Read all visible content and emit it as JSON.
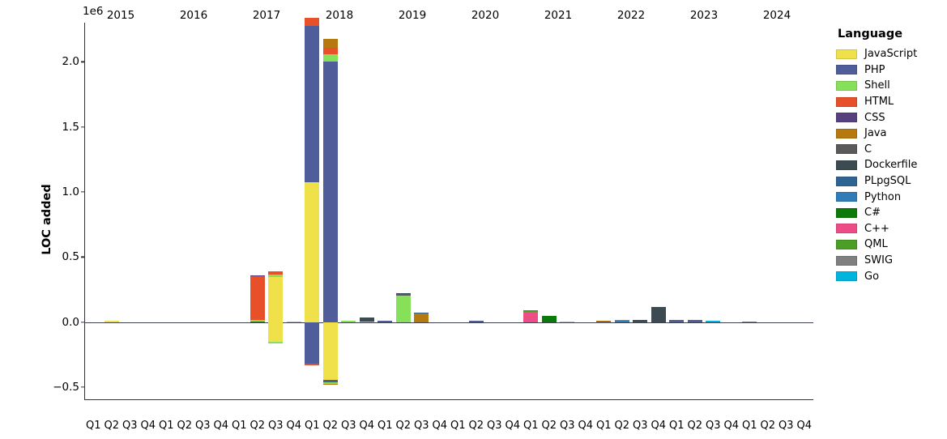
{
  "chart_data": {
    "type": "bar",
    "subtype": "stacked-bar",
    "title": "",
    "xlabel": "",
    "ylabel": "LOC added",
    "y_offset_label": "1e6",
    "ylim": [
      -600000,
      2300000
    ],
    "ytick_values": [
      -500000,
      0,
      500000,
      1000000,
      1500000,
      2000000
    ],
    "ytick_labels": [
      "−0.5",
      "0.0",
      "0.5",
      "1.0",
      "1.5",
      "2.0"
    ],
    "grid": false,
    "legend_position": "right",
    "legend_title": "Language",
    "quarter_labels": [
      "Q1",
      "Q2",
      "Q3",
      "Q4"
    ],
    "years": [
      "2015",
      "2016",
      "2017",
      "2018",
      "2019",
      "2020",
      "2021",
      "2022",
      "2023",
      "2024"
    ],
    "categories": [
      "2015Q1",
      "2015Q2",
      "2015Q3",
      "2015Q4",
      "2016Q1",
      "2016Q2",
      "2016Q3",
      "2016Q4",
      "2017Q1",
      "2017Q2",
      "2017Q3",
      "2017Q4",
      "2018Q1",
      "2018Q2",
      "2018Q3",
      "2018Q4",
      "2019Q1",
      "2019Q2",
      "2019Q3",
      "2019Q4",
      "2020Q1",
      "2020Q2",
      "2020Q3",
      "2020Q4",
      "2021Q1",
      "2021Q2",
      "2021Q3",
      "2021Q4",
      "2022Q1",
      "2022Q2",
      "2022Q3",
      "2022Q4",
      "2023Q1",
      "2023Q2",
      "2023Q3",
      "2023Q4",
      "2024Q1",
      "2024Q2",
      "2024Q3",
      "2024Q4"
    ],
    "series": [
      {
        "name": "JavaScript",
        "color": "#f0e14a",
        "values": [
          0,
          9000,
          0,
          0,
          0,
          0,
          0,
          0,
          0,
          0,
          345000,
          0,
          1075000,
          -16000,
          0,
          0,
          0,
          0,
          0,
          0,
          0,
          0,
          0,
          0,
          0,
          0,
          0,
          0,
          0,
          0,
          0,
          0,
          0,
          0,
          0,
          0,
          0,
          0,
          0,
          0
        ]
      },
      {
        "name": "PHP",
        "color": "#4f5d9b",
        "values": [
          0,
          0,
          0,
          0,
          0,
          0,
          0,
          0,
          0,
          5000,
          0,
          0,
          1200000,
          2000000,
          0,
          0,
          11000,
          0,
          0,
          0,
          0,
          10000,
          0,
          0,
          0,
          0,
          0,
          0,
          1500,
          0,
          0,
          0,
          17000,
          13000,
          0,
          0,
          0,
          0,
          0,
          0
        ]
      },
      {
        "name": "Shell",
        "color": "#86e05a",
        "values": [
          0,
          0,
          0,
          0,
          0,
          0,
          0,
          0,
          0,
          14000,
          22000,
          6000,
          0,
          60000,
          10000,
          4000,
          0,
          205000,
          0,
          0,
          0,
          0,
          0,
          0,
          0,
          0,
          3000,
          0,
          0,
          0,
          0,
          0,
          0,
          0,
          0,
          0,
          0,
          0,
          0,
          0
        ]
      },
      {
        "name": "HTML",
        "color": "#e8502a",
        "values": [
          0,
          0,
          0,
          0,
          0,
          0,
          0,
          0,
          0,
          334000,
          22000,
          0,
          65000,
          45000,
          0,
          0,
          0,
          0,
          0,
          0,
          0,
          0,
          0,
          0,
          0,
          0,
          0,
          0,
          0,
          0,
          0,
          0,
          0,
          0,
          0,
          0,
          0,
          0,
          0,
          0
        ]
      },
      {
        "name": "CSS",
        "color": "#56407e",
        "values": [
          0,
          0,
          0,
          0,
          0,
          0,
          0,
          0,
          0,
          4000,
          0,
          0,
          0,
          0,
          0,
          0,
          0,
          0,
          0,
          0,
          0,
          0,
          0,
          0,
          0,
          0,
          0,
          0,
          0,
          0,
          5000,
          0,
          0,
          0,
          0,
          0,
          0,
          0,
          0,
          0
        ]
      },
      {
        "name": "Java",
        "color": "#b5790f",
        "values": [
          0,
          0,
          0,
          0,
          0,
          0,
          0,
          0,
          0,
          0,
          0,
          0,
          0,
          70000,
          0,
          0,
          0,
          0,
          70000,
          0,
          0,
          0,
          0,
          0,
          0,
          0,
          0,
          0,
          10000,
          0,
          0,
          0,
          0,
          0,
          0,
          0,
          0,
          0,
          0,
          0
        ]
      },
      {
        "name": "C",
        "color": "#5a5a5a",
        "values": [
          0,
          0,
          0,
          0,
          0,
          0,
          0,
          0,
          0,
          0,
          0,
          0,
          0,
          0,
          0,
          0,
          0,
          11000,
          0,
          0,
          0,
          0,
          0,
          0,
          0,
          0,
          0,
          0,
          0,
          0,
          0,
          0,
          0,
          0,
          0,
          0,
          0,
          0,
          0,
          0
        ]
      },
      {
        "name": "Dockerfile",
        "color": "#3c4a52",
        "values": [
          0,
          0,
          0,
          0,
          0,
          0,
          0,
          0,
          0,
          0,
          0,
          0,
          0,
          0,
          0,
          28000,
          0,
          4000,
          0,
          0,
          0,
          0,
          0,
          0,
          0,
          0,
          0,
          0,
          0,
          0,
          9000,
          115000,
          0,
          0,
          0,
          0,
          0,
          0,
          0,
          0
        ]
      },
      {
        "name": "PLpgSQL",
        "color": "#2e6491",
        "values": [
          0,
          0,
          0,
          0,
          0,
          0,
          0,
          0,
          0,
          0,
          0,
          0,
          0,
          0,
          0,
          0,
          0,
          0,
          5000,
          0,
          0,
          0,
          0,
          0,
          0,
          0,
          0,
          0,
          0,
          0,
          0,
          0,
          0,
          0,
          0,
          0,
          0,
          0,
          0,
          0
        ]
      },
      {
        "name": "Python",
        "color": "#2f7cb8",
        "values": [
          0,
          0,
          0,
          0,
          0,
          0,
          0,
          0,
          0,
          0,
          0,
          0,
          0,
          0,
          0,
          0,
          0,
          0,
          0,
          0,
          0,
          0,
          0,
          0,
          0,
          0,
          0,
          0,
          0,
          8000,
          0,
          0,
          0,
          0,
          0,
          0,
          0,
          0,
          0,
          0
        ]
      },
      {
        "name": "C#",
        "color": "#0b7a0b",
        "values": [
          0,
          0,
          0,
          0,
          0,
          0,
          0,
          0,
          0,
          0,
          0,
          0,
          0,
          0,
          0,
          0,
          0,
          0,
          0,
          0,
          0,
          0,
          0,
          0,
          0,
          50000,
          0,
          0,
          0,
          0,
          0,
          0,
          0,
          0,
          0,
          0,
          0,
          0,
          0,
          0
        ]
      },
      {
        "name": "C++",
        "color": "#ee4c86",
        "values": [
          0,
          0,
          0,
          0,
          0,
          0,
          0,
          0,
          0,
          0,
          0,
          0,
          0,
          0,
          0,
          0,
          0,
          0,
          0,
          0,
          0,
          0,
          0,
          0,
          82000,
          0,
          0,
          0,
          0,
          0,
          0,
          0,
          0,
          0,
          0,
          0,
          0,
          0,
          0,
          0
        ]
      },
      {
        "name": "QML",
        "color": "#4a9e25",
        "values": [
          0,
          0,
          0,
          0,
          0,
          0,
          0,
          0,
          0,
          0,
          0,
          0,
          0,
          0,
          0,
          0,
          0,
          0,
          0,
          0,
          0,
          0,
          0,
          0,
          6000,
          0,
          0,
          0,
          0,
          0,
          0,
          0,
          0,
          0,
          0,
          0,
          0,
          0,
          0,
          0
        ]
      },
      {
        "name": "SWIG",
        "color": "#7f7f7f",
        "values": [
          0,
          0,
          0,
          0,
          0,
          0,
          0,
          0,
          0,
          0,
          0,
          0,
          0,
          0,
          0,
          0,
          0,
          0,
          0,
          0,
          0,
          0,
          0,
          0,
          0,
          0,
          0,
          0,
          0,
          0,
          0,
          0,
          0,
          0,
          0,
          0,
          0,
          0,
          0,
          0
        ]
      },
      {
        "name": "Go",
        "color": "#00b4dd",
        "values": [
          0,
          0,
          0,
          0,
          0,
          0,
          0,
          0,
          0,
          0,
          0,
          0,
          0,
          0,
          0,
          0,
          0,
          0,
          0,
          0,
          0,
          0,
          0,
          0,
          0,
          0,
          0,
          0,
          0,
          9000,
          0,
          0,
          0,
          0,
          9000,
          0,
          5000,
          0,
          0,
          0
        ]
      }
    ],
    "negative_series": [
      {
        "name": "JavaScript",
        "color": "#f0e14a",
        "values": [
          0,
          0,
          0,
          0,
          0,
          0,
          0,
          0,
          0,
          0,
          -155000,
          0,
          0,
          -445000,
          0,
          0,
          0,
          0,
          0,
          0,
          0,
          0,
          0,
          0,
          0,
          0,
          0,
          0,
          0,
          0,
          0,
          0,
          0,
          0,
          0,
          0,
          0,
          0,
          0,
          0
        ]
      },
      {
        "name": "PHP",
        "color": "#4f5d9b",
        "values": [
          0,
          0,
          0,
          0,
          0,
          0,
          0,
          0,
          0,
          0,
          0,
          0,
          -320000,
          -20000,
          0,
          0,
          0,
          0,
          0,
          0,
          0,
          0,
          0,
          0,
          0,
          0,
          0,
          0,
          0,
          0,
          0,
          0,
          0,
          0,
          0,
          0,
          0,
          0,
          0,
          0
        ]
      },
      {
        "name": "HTML",
        "color": "#e8502a",
        "values": [
          0,
          0,
          0,
          0,
          0,
          0,
          0,
          0,
          0,
          0,
          0,
          0,
          -10000,
          0,
          0,
          0,
          0,
          0,
          0,
          0,
          0,
          0,
          0,
          0,
          0,
          0,
          0,
          0,
          0,
          0,
          0,
          0,
          0,
          0,
          0,
          0,
          0,
          0,
          0,
          0
        ]
      },
      {
        "name": "Shell",
        "color": "#86e05a",
        "values": [
          0,
          0,
          0,
          0,
          0,
          0,
          0,
          0,
          0,
          0,
          -7000,
          0,
          0,
          -8000,
          0,
          0,
          0,
          0,
          0,
          0,
          0,
          0,
          0,
          0,
          0,
          0,
          0,
          0,
          0,
          0,
          0,
          0,
          0,
          0,
          0,
          0,
          0,
          0,
          0,
          0
        ]
      },
      {
        "name": "Java",
        "color": "#b5790f",
        "values": [
          0,
          0,
          0,
          0,
          0,
          0,
          0,
          0,
          0,
          0,
          0,
          0,
          0,
          -7000,
          0,
          0,
          0,
          0,
          0,
          0,
          0,
          0,
          0,
          0,
          0,
          0,
          0,
          0,
          0,
          0,
          0,
          0,
          0,
          0,
          0,
          0,
          0,
          0,
          0,
          0
        ]
      }
    ],
    "bar_totals_positive": [
      0,
      9000,
      0,
      0,
      0,
      0,
      0,
      0,
      0,
      357000,
      389000,
      6000,
      1272000,
      2175000,
      10000,
      32000,
      11000,
      220000,
      75000,
      0,
      0,
      10000,
      0,
      0,
      88000,
      50000,
      3000,
      0,
      11500,
      17000,
      14000,
      115000,
      17000,
      13000,
      9000,
      0,
      5000,
      0,
      0,
      0
    ],
    "bar_totals_negative": [
      0,
      0,
      0,
      0,
      0,
      0,
      0,
      0,
      0,
      0,
      -162000,
      0,
      -330000,
      -480000,
      0,
      0,
      0,
      0,
      0,
      0,
      0,
      0,
      0,
      0,
      0,
      0,
      0,
      0,
      0,
      0,
      0,
      0,
      0,
      0,
      0,
      0,
      0,
      0,
      0,
      0
    ]
  }
}
